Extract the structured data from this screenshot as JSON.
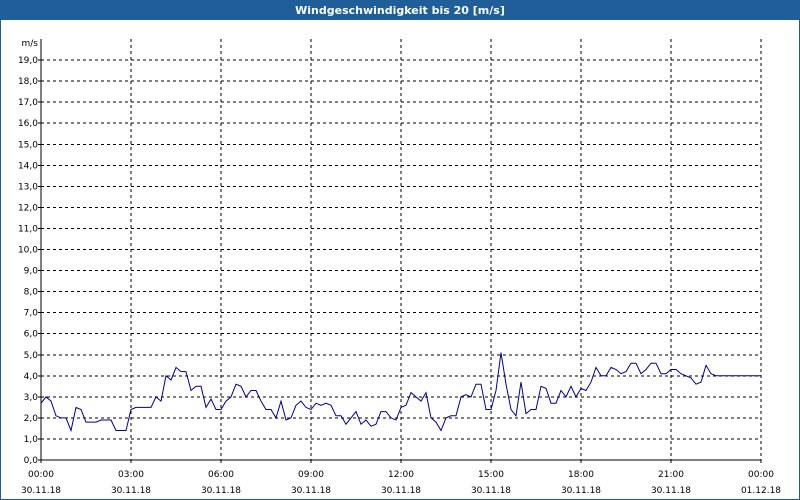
{
  "window": {
    "title": "Windgeschwindigkeit bis 20 [m/s]"
  },
  "colors": {
    "titlebar": "#1f5e98",
    "series": "#00008b",
    "grid": "#000000"
  },
  "chart_data": {
    "type": "line",
    "title": "Windgeschwindigkeit bis 20 [m/s]",
    "ylabel": "m/s",
    "xlabel": "",
    "ylim": [
      0,
      20
    ],
    "xlim_hours": [
      0,
      24
    ],
    "grid": true,
    "y_ticks": [
      "0,0",
      "1,0",
      "2,0",
      "3,0",
      "4,0",
      "5,0",
      "6,0",
      "7,0",
      "8,0",
      "9,0",
      "10,0",
      "11,0",
      "12,0",
      "13,0",
      "14,0",
      "15,0",
      "16,0",
      "17,0",
      "18,0",
      "19,0"
    ],
    "x_ticks": [
      {
        "time": "00:00",
        "date": "30.11.18"
      },
      {
        "time": "03:00",
        "date": "30.11.18"
      },
      {
        "time": "06:00",
        "date": "30.11.18"
      },
      {
        "time": "09:00",
        "date": "30.11.18"
      },
      {
        "time": "12:00",
        "date": "30.11.18"
      },
      {
        "time": "15:00",
        "date": "30.11.18"
      },
      {
        "time": "18:00",
        "date": "30.11.18"
      },
      {
        "time": "21:00",
        "date": "30.11.18"
      },
      {
        "time": "00:00",
        "date": "01.12.18"
      }
    ],
    "series": [
      {
        "x": [
          "00:00",
          "00:10",
          "00:20",
          "00:30",
          "00:40",
          "00:50",
          "01:00",
          "01:10",
          "01:20",
          "01:30",
          "01:40",
          "01:50",
          "02:00",
          "02:10",
          "02:20",
          "02:30",
          "02:40",
          "02:50",
          "03:00",
          "03:10",
          "03:20",
          "03:30",
          "03:40",
          "03:50",
          "04:00",
          "04:10",
          "04:20",
          "04:30",
          "04:40",
          "04:50",
          "05:00",
          "05:10",
          "05:20",
          "05:30",
          "05:40",
          "05:50",
          "06:00",
          "06:10",
          "06:20",
          "06:30",
          "06:40",
          "06:50",
          "07:00",
          "07:10",
          "07:20",
          "07:30",
          "07:40",
          "07:50",
          "08:00",
          "08:10",
          "08:20",
          "08:30",
          "08:40",
          "08:50",
          "09:00",
          "09:10",
          "09:20",
          "09:30",
          "09:40",
          "09:50",
          "10:00",
          "10:10",
          "10:20",
          "10:30",
          "10:40",
          "10:50",
          "11:00",
          "11:10",
          "11:20",
          "11:30",
          "11:40",
          "11:50",
          "12:00",
          "12:10",
          "12:20",
          "12:30",
          "12:40",
          "12:50",
          "13:00",
          "13:10",
          "13:20",
          "13:30",
          "13:40",
          "13:50",
          "14:00",
          "14:10",
          "14:20",
          "14:30",
          "14:40",
          "14:50",
          "15:00",
          "15:10",
          "15:20",
          "15:30",
          "15:40",
          "15:50",
          "16:00",
          "16:10",
          "16:20",
          "16:30",
          "16:40",
          "16:50",
          "17:00",
          "17:10",
          "17:20",
          "17:30",
          "17:40",
          "17:50",
          "18:00",
          "18:10",
          "18:20",
          "18:30",
          "18:40",
          "18:50",
          "19:00",
          "19:10",
          "19:20",
          "19:30",
          "19:40",
          "19:50",
          "20:00",
          "20:10",
          "20:20",
          "20:30",
          "20:40",
          "20:50",
          "21:00",
          "21:10",
          "21:20",
          "21:30",
          "21:40",
          "21:50",
          "22:00",
          "22:10",
          "22:20",
          "22:30",
          "22:40",
          "22:50",
          "23:00",
          "23:10",
          "23:20",
          "23:30",
          "23:40",
          "23:50",
          "24:00"
        ],
        "values": [
          2.7,
          3.0,
          2.8,
          2.1,
          2.0,
          2.0,
          1.4,
          2.5,
          2.4,
          1.8,
          1.8,
          1.8,
          1.9,
          1.9,
          1.9,
          1.4,
          1.4,
          1.4,
          2.4,
          2.5,
          2.5,
          2.5,
          2.5,
          3.0,
          2.8,
          4.0,
          3.8,
          4.4,
          4.2,
          4.2,
          3.3,
          3.5,
          3.5,
          2.5,
          2.9,
          2.4,
          2.4,
          2.8,
          3.0,
          3.6,
          3.5,
          3.0,
          3.3,
          3.3,
          2.8,
          2.4,
          2.4,
          2.0,
          2.8,
          1.9,
          2.0,
          2.6,
          2.8,
          2.5,
          2.4,
          2.7,
          2.6,
          2.7,
          2.6,
          2.1,
          2.1,
          1.7,
          2.0,
          2.3,
          1.7,
          1.9,
          1.6,
          1.7,
          2.3,
          2.3,
          2.0,
          1.9,
          2.5,
          2.6,
          3.2,
          3.0,
          2.8,
          3.2,
          2.0,
          1.8,
          1.4,
          2.0,
          2.1,
          2.1,
          3.0,
          3.1,
          3.0,
          3.6,
          3.6,
          2.4,
          2.4,
          3.3,
          5.1,
          3.6,
          2.4,
          2.1,
          3.7,
          2.2,
          2.4,
          2.4,
          3.5,
          3.4,
          2.7,
          2.7,
          3.3,
          3.0,
          3.5,
          3.0,
          3.4,
          3.3,
          3.7,
          4.4,
          4.0,
          4.0,
          4.4,
          4.3,
          4.1,
          4.2,
          4.6,
          4.6,
          4.1,
          4.3,
          4.6,
          4.6,
          4.1,
          4.1,
          4.3,
          4.3,
          4.1,
          4.0,
          3.9,
          3.6,
          3.7,
          4.5,
          4.1,
          4.0,
          4.0,
          4.0,
          4.0,
          4.0,
          4.0,
          4.0,
          4.0,
          4.0,
          4.0
        ]
      }
    ]
  }
}
